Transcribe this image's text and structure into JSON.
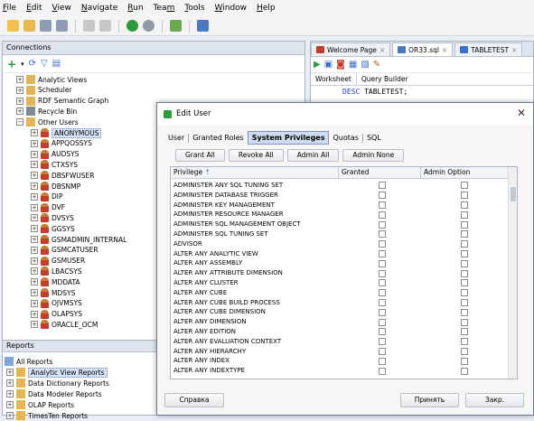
{
  "menu": [
    {
      "pre": "",
      "key": "F",
      "post": "ile"
    },
    {
      "pre": "",
      "key": "E",
      "post": "dit"
    },
    {
      "pre": "",
      "key": "V",
      "post": "iew"
    },
    {
      "pre": "",
      "key": "N",
      "post": "avigate"
    },
    {
      "pre": "",
      "key": "R",
      "post": "un"
    },
    {
      "pre": "Tea",
      "key": "m",
      "post": ""
    },
    {
      "pre": "",
      "key": "T",
      "post": "ools"
    },
    {
      "pre": "",
      "key": "W",
      "post": "indow"
    },
    {
      "pre": "",
      "key": "H",
      "post": "elp"
    }
  ],
  "connections": {
    "title": "Connections",
    "nodes": [
      {
        "label": "Analytic Views",
        "icon": "folder-icon"
      },
      {
        "label": "Scheduler",
        "icon": "folder-icon"
      },
      {
        "label": "RDF Semantic Graph",
        "icon": "folder-icon"
      },
      {
        "label": "Recycle Bin",
        "icon": "recycle-bin-icon"
      },
      {
        "label": "Other Users",
        "icon": "folder-icon"
      }
    ],
    "users": [
      "ANONYMOUS",
      "APPQOSSYS",
      "AUDSYS",
      "CTXSYS",
      "DBSFWUSER",
      "DBSNMP",
      "DIP",
      "DVF",
      "DVSYS",
      "GGSYS",
      "GSMADMIN_INTERNAL",
      "GSMCATUSER",
      "GSMUSER",
      "LBACSYS",
      "MDDATA",
      "MDSYS",
      "OJVMSYS",
      "OLAPSYS",
      "ORACLE_OCM"
    ],
    "selected_user": "ANONYMOUS"
  },
  "reports": {
    "title": "Reports",
    "items": [
      "All Reports",
      "Analytic View Reports",
      "Data Dictionary Reports",
      "Data Modeler Reports",
      "OLAP Reports",
      "TimesTen Reports"
    ]
  },
  "editor": {
    "tabs": [
      {
        "label": "Welcome Page",
        "icon": "oracle-icon"
      },
      {
        "label": "OR33.sql",
        "icon": "sql-icon"
      },
      {
        "label": "TABLETEST",
        "icon": "table-icon"
      }
    ],
    "subtabs": [
      "Worksheet",
      "Query Builder"
    ],
    "code_kw": "DESC",
    "code_rest": " TABLETEST;"
  },
  "dialog": {
    "title": "Edit User",
    "tabs": [
      "User",
      "Granted Roles",
      "System Privileges",
      "Quotas",
      "SQL"
    ],
    "active_tab": "System Privileges",
    "grant_buttons": [
      "Grant All",
      "Revoke All",
      "Admin All",
      "Admin None"
    ],
    "columns": [
      "Privilege",
      "Granted",
      "Admin Option"
    ],
    "privileges": [
      "ADMINISTER ANY SQL TUNING SET",
      "ADMINISTER DATABASE TRIGGER",
      "ADMINISTER KEY MANAGEMENT",
      "ADMINISTER RESOURCE MANAGER",
      "ADMINISTER SQL MANAGEMENT OBJECT",
      "ADMINISTER SQL TUNING SET",
      "ADVISOR",
      "ALTER ANY ANALYTIC VIEW",
      "ALTER ANY ASSEMBLY",
      "ALTER ANY ATTRIBUTE DIMENSION",
      "ALTER ANY CLUSTER",
      "ALTER ANY CUBE",
      "ALTER ANY CUBE BUILD PROCESS",
      "ALTER ANY CUBE DIMENSION",
      "ALTER ANY DIMENSION",
      "ALTER ANY EDITION",
      "ALTER ANY EVALUATION CONTEXT",
      "ALTER ANY HIERARCHY",
      "ALTER ANY INDEX",
      "ALTER ANY INDEXTYPE"
    ],
    "footer": {
      "help": "Справка",
      "apply": "Принять",
      "close": "Закр."
    }
  },
  "colors": {
    "accent": "#3a6fd0",
    "selected_tab": "#cfdcf0"
  }
}
